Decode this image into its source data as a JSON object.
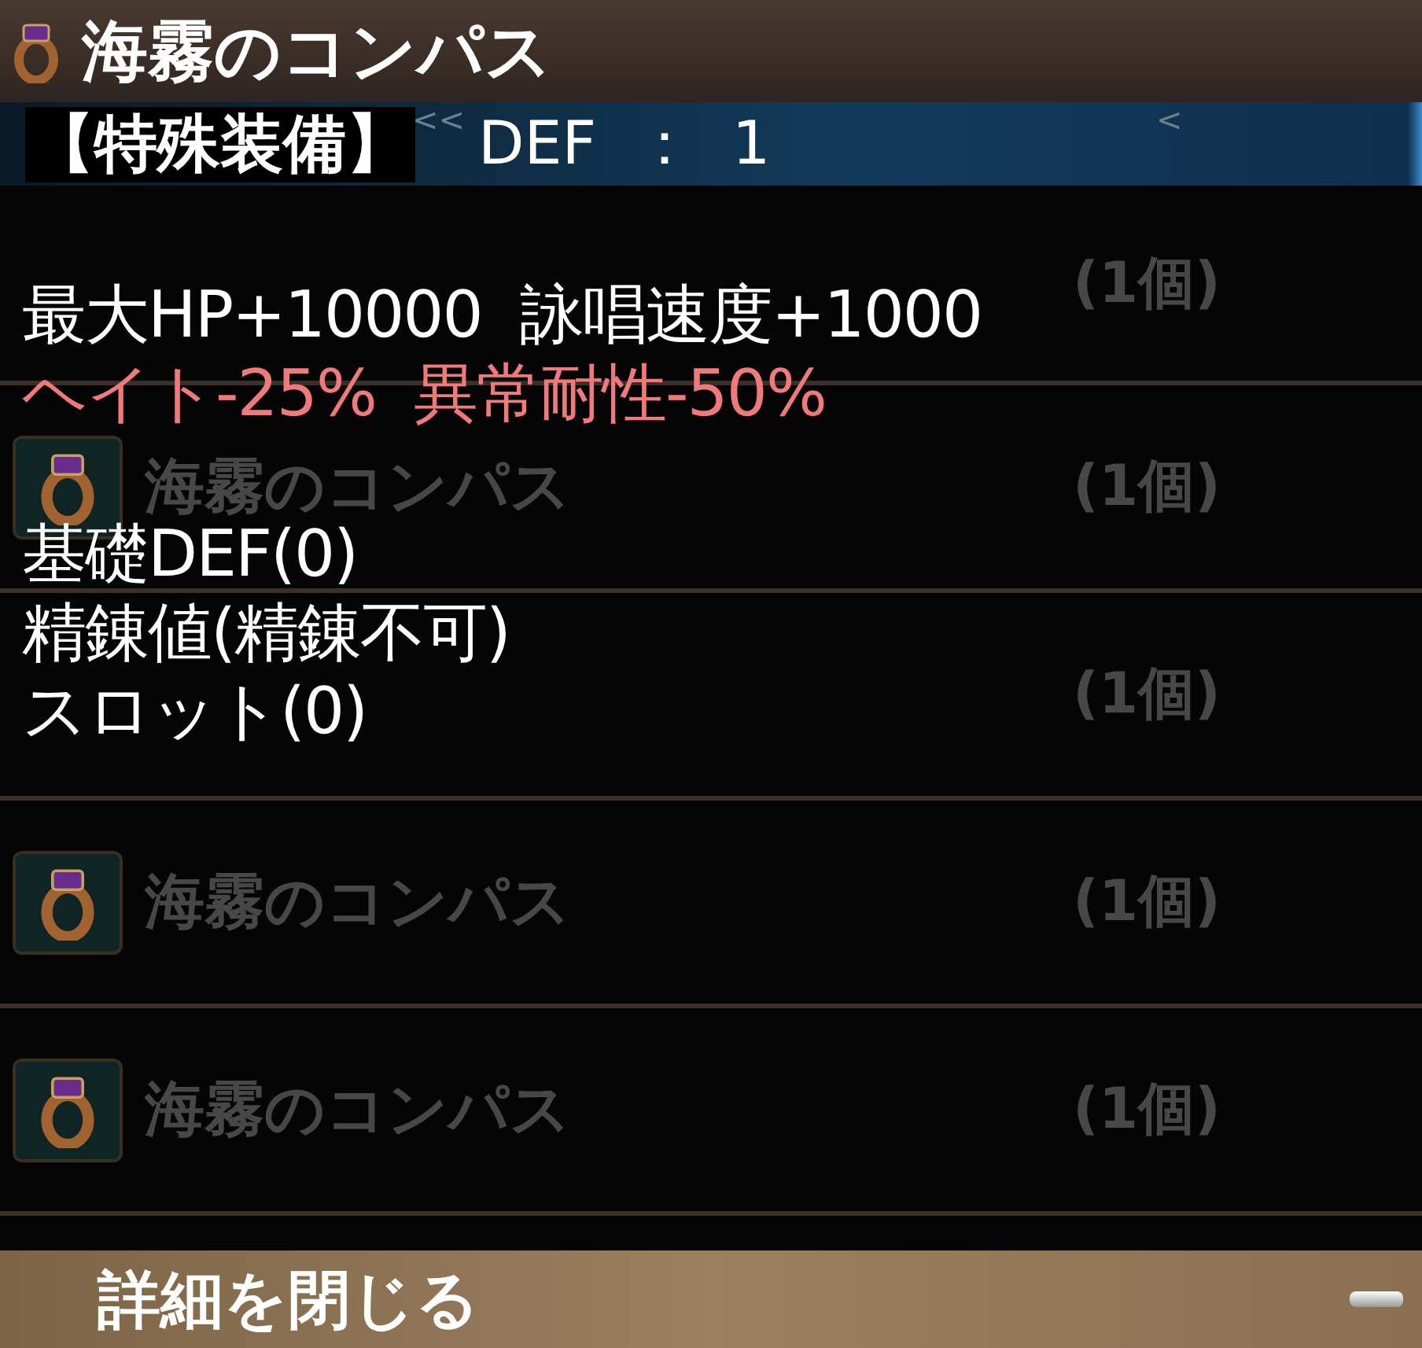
{
  "item": {
    "name": "海霧のコンパス"
  },
  "info": {
    "category": "【特殊装備】",
    "stat": "DEF  ：  1"
  },
  "nav_buttons": [
    "<<",
    "<"
  ],
  "detail": {
    "effects": [
      {
        "text": "最大HP+10000  詠唱速度+1000",
        "kind": "bonus"
      },
      {
        "text": "ヘイト-25%  異常耐性-50%",
        "kind": "penalty"
      }
    ],
    "properties": [
      "基礎DEF(0)",
      "精錬値(精錬不可)",
      "スロット(0)"
    ]
  },
  "list_rows": [
    {
      "count": "(1個)"
    },
    {
      "name": "海霧のコンパス",
      "count": "(1個)"
    },
    {
      "count": "(1個)"
    },
    {
      "name": "海霧のコンパス",
      "count": "(1個)"
    },
    {
      "name": "海霧のコンパス",
      "count": "(1個)"
    }
  ],
  "close_button": {
    "label": "詳細を閉じる"
  }
}
